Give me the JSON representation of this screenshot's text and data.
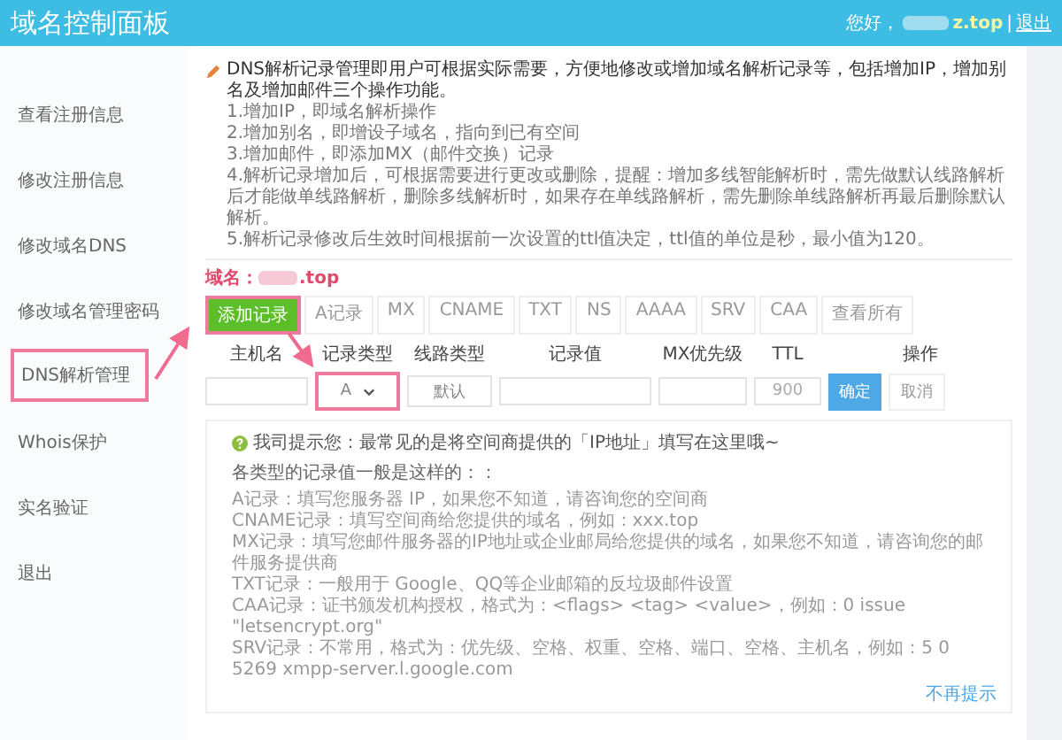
{
  "header": {
    "title": "域名控制面板",
    "greeting": "您好，",
    "account": "z.top",
    "separator": "|",
    "logout": "退出"
  },
  "sidebar": {
    "items": [
      {
        "label": "查看注册信息",
        "selected": false
      },
      {
        "label": "修改注册信息",
        "selected": false
      },
      {
        "label": "修改域名DNS",
        "selected": false
      },
      {
        "label": "修改域名管理密码",
        "selected": false
      },
      {
        "label": "DNS解析管理",
        "selected": true
      },
      {
        "label": "Whois保护",
        "selected": false
      },
      {
        "label": "实名验证",
        "selected": false
      },
      {
        "label": "退出",
        "selected": false
      }
    ]
  },
  "intro": {
    "text": "DNS解析记录管理即用户可根据实际需要，方便地修改或增加域名解析记录等，包括增加IP，增加别名及增加邮件三个操作功能。",
    "items": [
      "1.增加IP，即域名解析操作",
      "2.增加别名，即增设子域名，指向到已有空间",
      "3.增加邮件，即添加MX（邮件交换）记录",
      "4.解析记录增加后，可根据需要进行更改或删除，提醒：增加多线智能解析时，需先做默认线路解析后才能做单线路解析，删除多线解析时，如果存在单线路解析，需先删除单线路解析再最后删除默认解析。",
      "5.解析记录修改后生效时间根据前一次设置的ttl值决定，ttl值的单位是秒，最小值为120。"
    ]
  },
  "domain": {
    "label": "域名：",
    "suffix": ".top"
  },
  "tabs": [
    {
      "label": "添加记录",
      "selected": true
    },
    {
      "label": "A记录",
      "selected": false
    },
    {
      "label": "MX",
      "selected": false
    },
    {
      "label": "CNAME",
      "selected": false
    },
    {
      "label": "TXT",
      "selected": false
    },
    {
      "label": "NS",
      "selected": false
    },
    {
      "label": "AAAA",
      "selected": false
    },
    {
      "label": "SRV",
      "selected": false
    },
    {
      "label": "CAA",
      "selected": false
    },
    {
      "label": "查看所有",
      "selected": false
    }
  ],
  "table": {
    "columns": [
      "主机名",
      "记录类型",
      "线路类型",
      "记录值",
      "MX优先级",
      "TTL",
      "操作"
    ],
    "row": {
      "record_type": "A",
      "line_type": "默认",
      "ttl": "900",
      "confirm": "确定",
      "cancel": "取消"
    }
  },
  "tip": {
    "title": "我司提示您：最常见的是将空间商提供的「IP地址」填写在这里哦~",
    "subtitle": "各类型的记录值一般是这样的：：",
    "lines": [
      "A记录：填写您服务器 IP，如果您不知道，请咨询您的空间商",
      "CNAME记录：填写空间商给您提供的域名，例如：xxx.top",
      "MX记录：填写您邮件服务器的IP地址或企业邮局给您提供的域名，如果您不知道，请咨询您的邮件服务提供商",
      "TXT记录：一般用于 Google、QQ等企业邮箱的反垃圾邮件设置",
      "CAA记录：证书颁发机构授权，格式为：<flags> <tag> <value>，例如：0 issue \"letsencrypt.org\"",
      "SRV记录：不常用，格式为：优先级、空格、权重、空格、端口、空格、主机名，例如：5 0 5269 xmpp-server.l.google.com"
    ],
    "dismiss": "不再提示"
  }
}
